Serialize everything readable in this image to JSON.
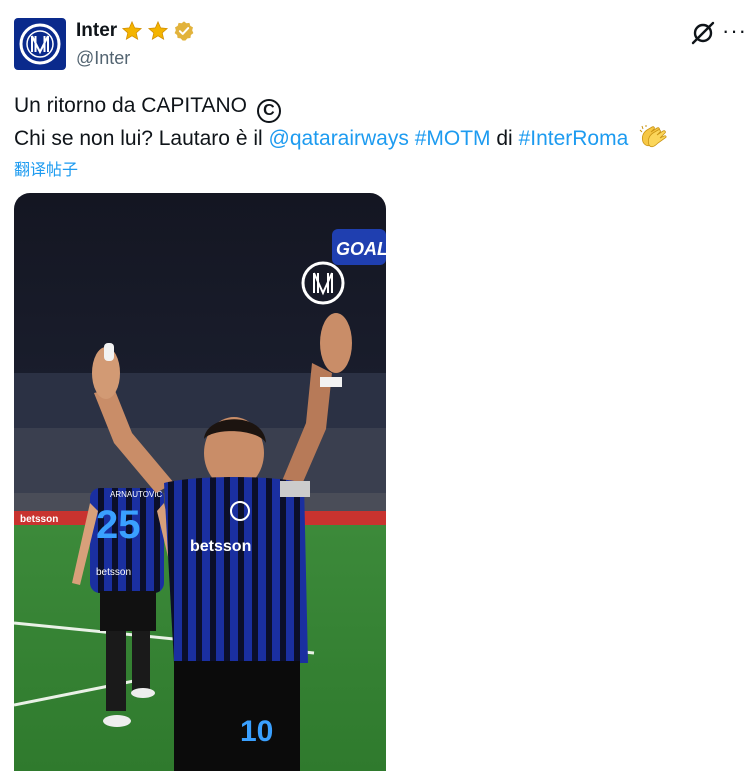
{
  "account": {
    "display_name": "Inter",
    "handle": "@Inter",
    "badges": [
      "star-icon",
      "star-icon",
      "verified-badge-icon"
    ]
  },
  "tweet": {
    "line1": "Un ritorno da CAPITANO",
    "line1_symbol": "C",
    "line2_prefix": "Chi se non lui? Lautaro è il ",
    "mention": "@qatarairways",
    "hashtag_motm": "#MOTM",
    "connector": " di ",
    "hashtag_match": "#InterRoma",
    "emoji": "clapping-hands-icon"
  },
  "translate_label": "翻译帖子",
  "media": {
    "overlay_text": "GOAL",
    "sponsor_board": "betsson",
    "player_main_number": "10",
    "player_main_sponsor": "betsson",
    "player_back_name": "ARNAUTOVIC",
    "player_back_number": "25",
    "player_back_sponsor": "betsson"
  },
  "colors": {
    "link": "#1d9bf0",
    "handle": "#536471",
    "inter_blue": "#0a2a8c",
    "star": "#f4b400",
    "verified": "#e2b33c"
  }
}
